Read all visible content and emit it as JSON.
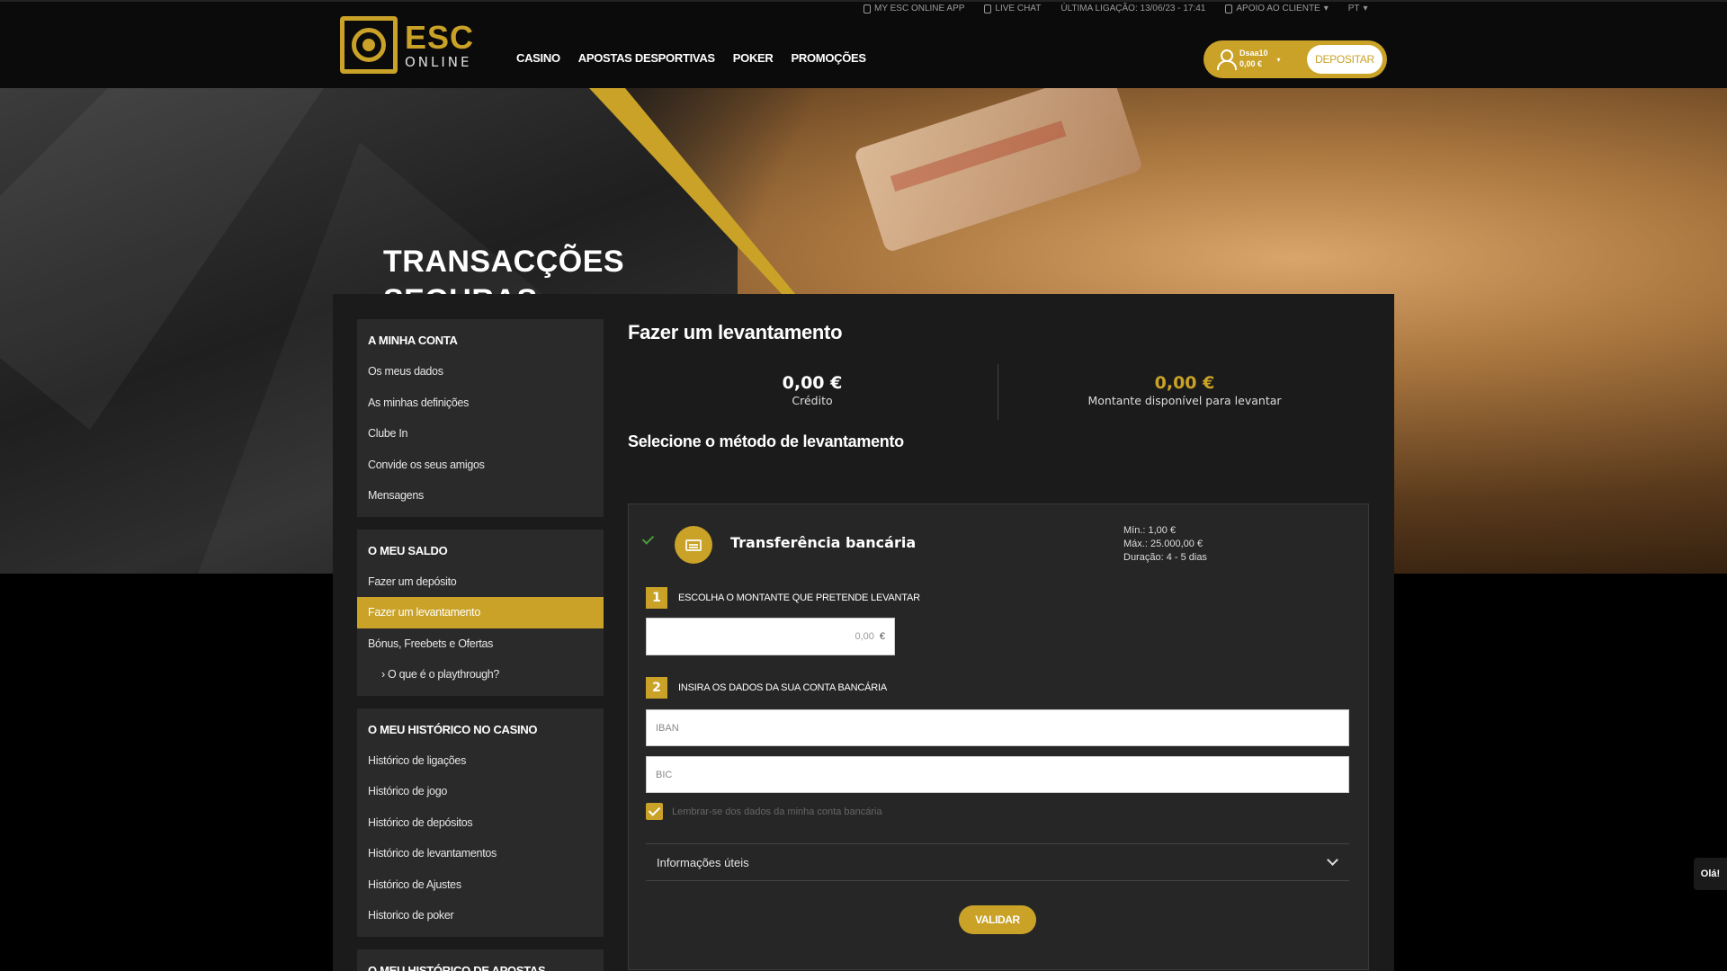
{
  "topbar": {
    "app": "MY ESC ONLINE APP",
    "chat": "LIVE CHAT",
    "last_login": "ÚLTIMA LIGAÇÃO: 13/06/23 - 17:41",
    "support": "APOIO AO CLIENTE",
    "lang": "PT"
  },
  "logo": {
    "esc": "ESC",
    "online": "ONLINE"
  },
  "nav": [
    "CASINO",
    "APOSTAS DESPORTIVAS",
    "POKER",
    "PROMOÇÕES"
  ],
  "user": {
    "name": "Dsaa10",
    "balance": "0,00 €",
    "deposit_label": "DEPOSITAR"
  },
  "hero": {
    "title_line1": "TRANSACÇÕES",
    "title_line2": "SEGURAS"
  },
  "sidebar": [
    {
      "title": "A MINHA CONTA",
      "items": [
        "Os meus dados",
        "As minhas definições",
        "Clube In",
        "Convide os seus amigos",
        "Mensagens"
      ]
    },
    {
      "title": "O MEU SALDO",
      "items": [
        "Fazer um depósito",
        "Fazer um levantamento",
        "Bónus, Freebets e Ofertas",
        "› O que é o playthrough?"
      ],
      "active_index": 1
    },
    {
      "title": "O MEU HISTÓRICO NO CASINO",
      "items": [
        "Histórico de ligações",
        "Histórico de jogo",
        "Histórico de depósitos",
        "Histórico de levantamentos",
        "Histórico de Ajustes",
        "Historico de poker"
      ]
    },
    {
      "title": "O MEU HISTÓRICO DE APOSTAS DESPORTIVAS",
      "items": []
    }
  ],
  "main": {
    "title": "Fazer um levantamento",
    "credit_value": "0,00 €",
    "credit_label": "Crédito",
    "available_value": "0,00 €",
    "available_label": "Montante disponível para levantar",
    "section_title": "Selecione o método de levantamento",
    "method": {
      "name": "Transferência bancária",
      "min": "Mín.: 1,00 €",
      "max": "Máx.: 25.000,00 €",
      "duration": "Duração: 4 - 5 dias"
    },
    "step1_num": "1",
    "step1_label": "ESCOLHA O MONTANTE QUE PRETENDE LEVANTAR",
    "amount_placeholder": "0,00",
    "amount_currency": "€",
    "step2_num": "2",
    "step2_label": "INSIRA OS DADOS DA SUA CONTA BANCÁRIA",
    "iban_placeholder": "IBAN",
    "bic_placeholder": "BIC",
    "remember_label": "Lembrar-se dos dados da minha conta bancária",
    "info_label": "Informações úteis",
    "validate_label": "VALIDAR"
  },
  "chat_tab": "Olá!",
  "colors": {
    "gold": "#c9a227",
    "bg": "#000000",
    "panel": "#1b1b1b"
  }
}
